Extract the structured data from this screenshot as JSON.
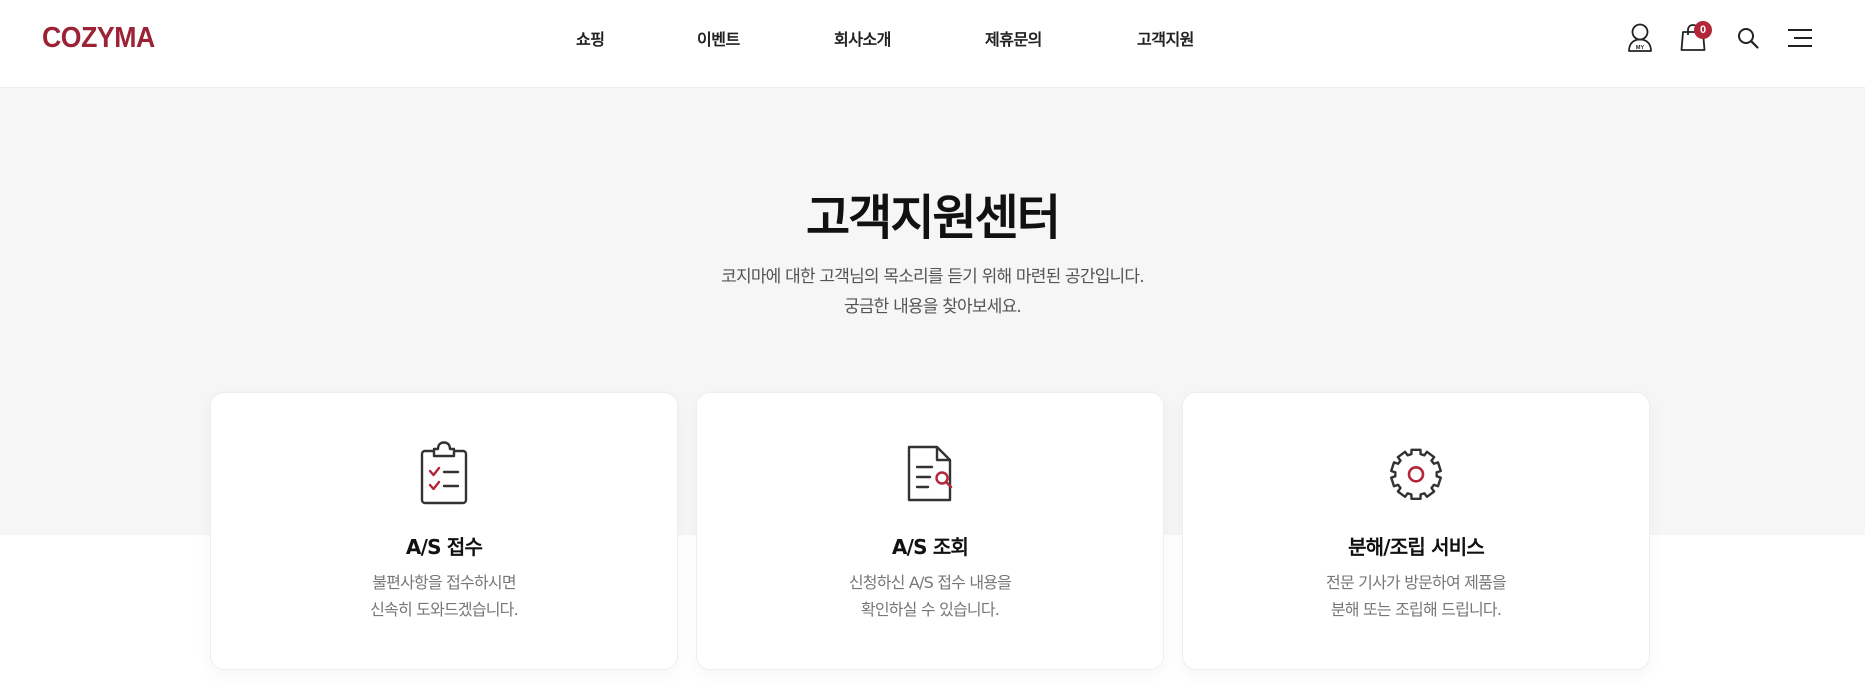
{
  "header": {
    "logo": "COZYMA",
    "nav": [
      "쇼핑",
      "이벤트",
      "회사소개",
      "제휴문의",
      "고객지원"
    ],
    "icons": {
      "my": "user-icon",
      "my_label": "MY",
      "cart": "shopping-bag-icon",
      "search": "search-icon",
      "menu": "hamburger-menu-icon"
    },
    "cart_count": "0"
  },
  "hero": {
    "title": "고객지원센터",
    "desc_line1": "코지마에 대한 고객님의 목소리를 듣기 위해 마련된 공간입니다.",
    "desc_line2": "궁금한 내용을 찾아보세요."
  },
  "cards": [
    {
      "icon": "clipboard-checklist-icon",
      "title": "A/S 접수",
      "desc_line1": "불편사항을 접수하시면",
      "desc_line2": "신속히 도와드겠습니다."
    },
    {
      "icon": "document-search-icon",
      "title": "A/S 조회",
      "desc_line1": "신청하신 A/S 접수 내용을",
      "desc_line2": "확인하실 수 있습니다."
    },
    {
      "icon": "gear-icon",
      "title": "분해/조립 서비스",
      "desc_line1": "전문 기사가 방문하여 제품을",
      "desc_line2": "분해 또는 조립해 드립니다."
    }
  ],
  "colors": {
    "brand": "#9b2335",
    "accent_red": "#b3263a",
    "hero_bg": "#f6f6f6",
    "text_dark": "#111111",
    "text_muted": "#777777"
  }
}
